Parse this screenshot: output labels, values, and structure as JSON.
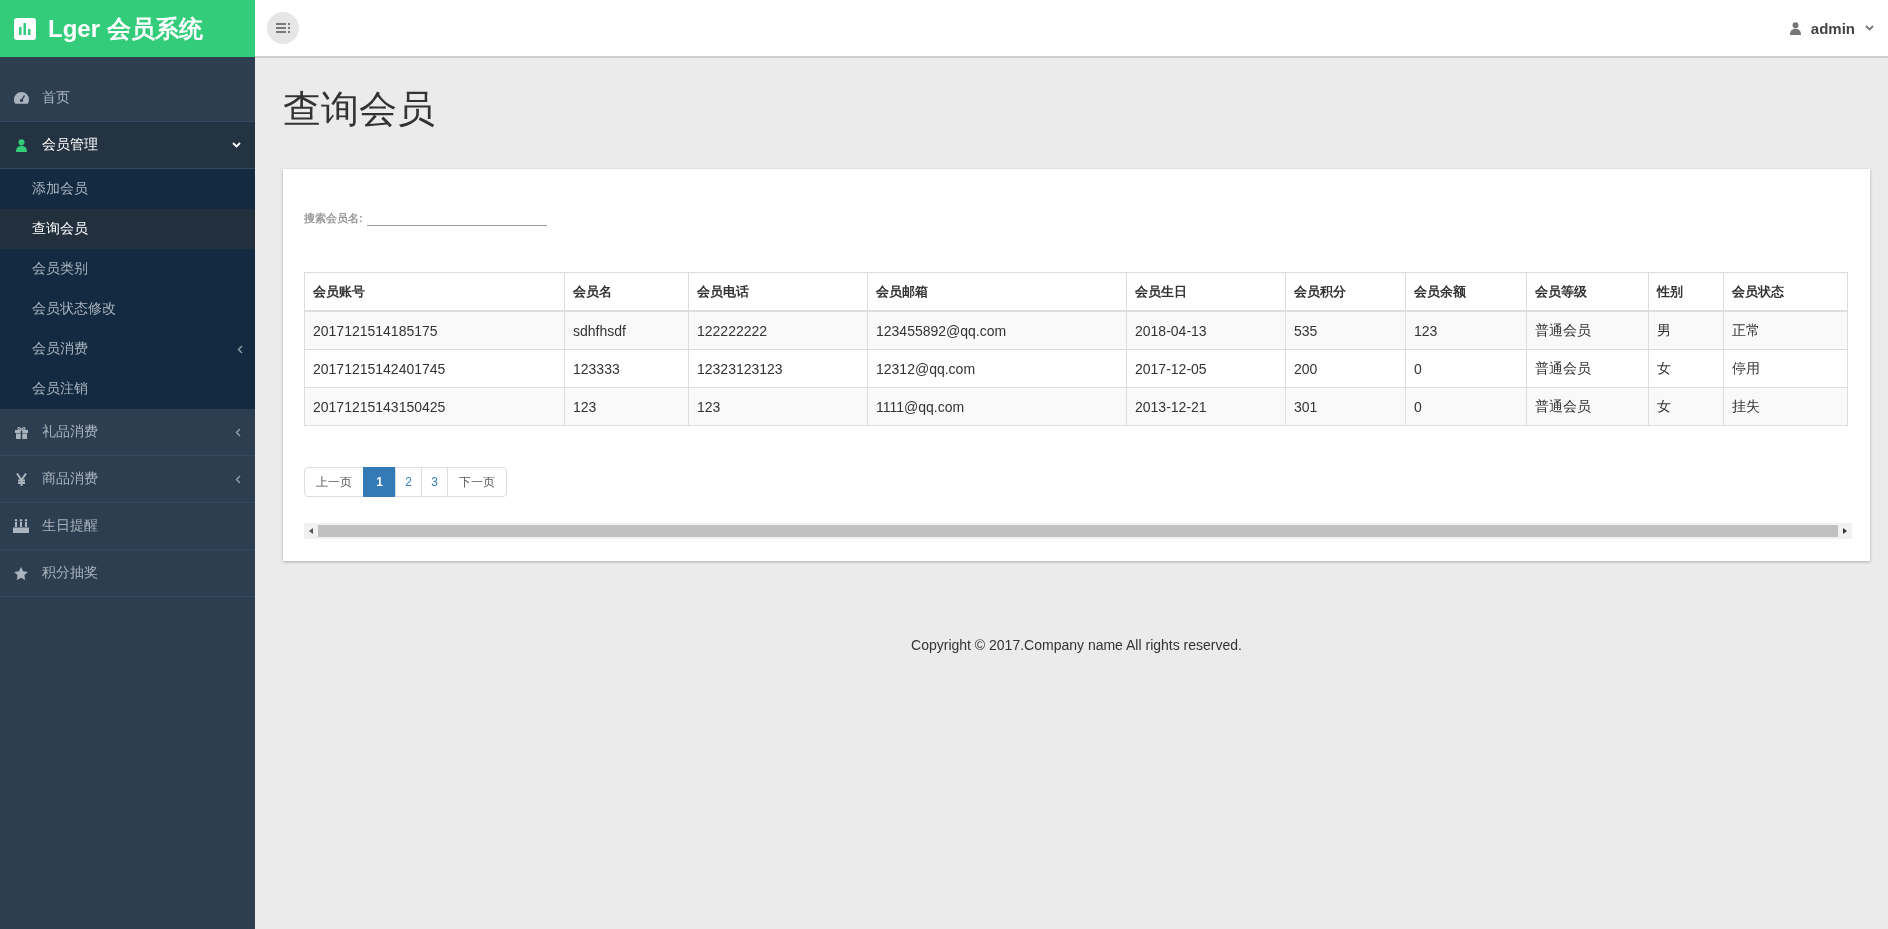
{
  "brand": {
    "title": "Lger 会员系统"
  },
  "header": {
    "user": "admin"
  },
  "sidebar": {
    "items": [
      {
        "label": "首页",
        "selected": false,
        "submenu": false
      },
      {
        "label": "会员管理",
        "selected": true,
        "submenu": true,
        "expanded": true,
        "children": [
          {
            "label": "添加会员",
            "selected": false,
            "submenu": false
          },
          {
            "label": "查询会员",
            "selected": true,
            "submenu": false
          },
          {
            "label": "会员类别",
            "selected": false,
            "submenu": false
          },
          {
            "label": "会员状态修改",
            "selected": false,
            "submenu": false
          },
          {
            "label": "会员消费",
            "selected": false,
            "submenu": true
          },
          {
            "label": "会员注销",
            "selected": false,
            "submenu": false
          }
        ]
      },
      {
        "label": "礼品消费",
        "selected": false,
        "submenu": true,
        "expanded": false
      },
      {
        "label": "商品消费",
        "selected": false,
        "submenu": true,
        "expanded": false
      },
      {
        "label": "生日提醒",
        "selected": false,
        "submenu": false
      },
      {
        "label": "积分抽奖",
        "selected": false,
        "submenu": false
      }
    ]
  },
  "page_title": "查询会员",
  "search": {
    "label": "搜索会员名:"
  },
  "table": {
    "columns": [
      "会员账号",
      "会员名",
      "会员电话",
      "会员邮箱",
      "会员生日",
      "会员积分",
      "会员余额",
      "会员等级",
      "性别",
      "会员状态"
    ],
    "rows": [
      [
        "2017121514185175",
        "sdhfhsdf",
        "122222222",
        "123455892@qq.com",
        "2018-04-13",
        "535",
        "123",
        "普通会员",
        "男",
        "正常"
      ],
      [
        "20171215142401745",
        "123333",
        "12323123123",
        "12312@qq.com",
        "2017-12-05",
        "200",
        "0",
        "普通会员",
        "女",
        "停用"
      ],
      [
        "20171215143150425",
        "123",
        "123",
        "1111@qq.com",
        "2013-12-21",
        "301",
        "0",
        "普通会员",
        "女",
        "挂失"
      ]
    ]
  },
  "pagination": {
    "previous": "上一页",
    "pages": [
      {
        "label": "1",
        "selected": true
      },
      {
        "label": "2",
        "selected": false
      },
      {
        "label": "3",
        "selected": false
      }
    ],
    "next": "下一页"
  },
  "footer": "Copyright © 2017.Company name All rights reserved."
}
